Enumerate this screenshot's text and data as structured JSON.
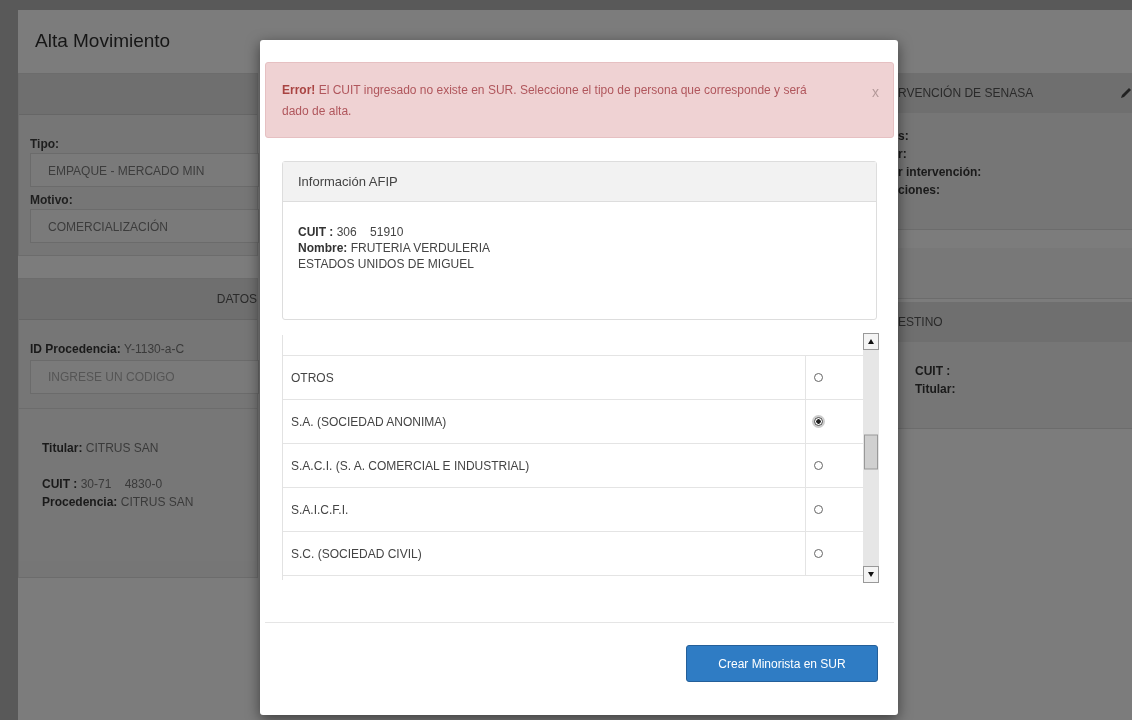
{
  "page": {
    "title": "Alta Movimiento",
    "left": {
      "tipo_label": "Tipo:",
      "tipo_value": "EMPAQUE - MERCADO MIN",
      "motivo_label": "Motivo:",
      "motivo_value": "COMERCIALIZACIÓN",
      "datos_header": "DATOS",
      "id_label": "ID Procedencia:",
      "id_value": "Y-1130-a-C",
      "codigo_placeholder": "INGRESE UN CODIGO",
      "titular_label": "Titular:",
      "titular_value": "CITRUS SAN",
      "cuit_label": "CUIT :",
      "cuit_value": "30-71    4830-0",
      "procedencia_label": "Procedencia:",
      "procedencia_value": "CITRUS SAN"
    },
    "right": {
      "header": "RVENCIÓN DE SENASA",
      "fields": [
        "s:",
        "r:",
        "r intervención:",
        "ciones:"
      ],
      "destino_header": "ESTINO",
      "destino_fields": [
        "CUIT :",
        "Titular:"
      ]
    }
  },
  "modal": {
    "alert": {
      "strong": "Error!",
      "message": "El CUIT ingresado no existe en SUR. Seleccione el tipo de persona que corresponde y será dado de alta.",
      "close": "x"
    },
    "afip": {
      "header": "Información AFIP",
      "cuit_label": "CUIT :",
      "cuit_value": "306    51910",
      "nombre_label": "Nombre:",
      "nombre_value": "FRUTERIA VERDULERIA",
      "nombre_continued": "ESTADOS UNIDOS DE MIGUEL"
    },
    "options": [
      {
        "label": "OTROS",
        "selected": false
      },
      {
        "label": "S.A. (SOCIEDAD ANONIMA)",
        "selected": true
      },
      {
        "label": "S.A.C.I. (S. A. COMERCIAL E INDUSTRIAL)",
        "selected": false
      },
      {
        "label": "S.A.I.C.F.I.",
        "selected": false
      },
      {
        "label": "S.C. (SOCIEDAD CIVIL)",
        "selected": false
      }
    ],
    "button": "Crear Minorista en SUR"
  }
}
